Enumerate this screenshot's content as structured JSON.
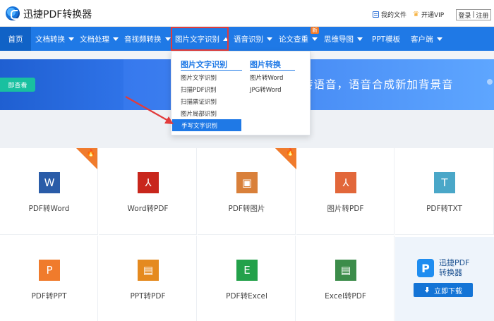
{
  "header": {
    "brand": "迅捷PDF转换器",
    "my_files": "我的文件",
    "vip": "开通VIP",
    "login": "登录",
    "register": "注册"
  },
  "nav": {
    "items": [
      {
        "label": "首页"
      },
      {
        "label": "文档转换"
      },
      {
        "label": "文档处理"
      },
      {
        "label": "音视频转换"
      },
      {
        "label": "图片文字识别"
      },
      {
        "label": "语音识别"
      },
      {
        "label": "论文查重"
      },
      {
        "label": "思维导图"
      },
      {
        "label": "PPT模板"
      },
      {
        "label": "客户端"
      }
    ],
    "new_badge": "新"
  },
  "banner": {
    "button": "即查看",
    "text": "转语音，语音合成新加背景音"
  },
  "dropdown": {
    "col1_title": "图片文字识别",
    "col1_items": [
      "图片文字识别",
      "扫描PDF识别",
      "扫描票证识别",
      "图片局部识别",
      "手写文字识别"
    ],
    "col2_title": "图片转换",
    "col2_items": [
      "图片转Word",
      "JPG转Word"
    ]
  },
  "tools": [
    {
      "label": "PDF转Word",
      "glyph": "W",
      "color": "#2a5ca8",
      "hot": true
    },
    {
      "label": "Word转PDF",
      "glyph": "⅄",
      "color": "#c8261c",
      "hot": false
    },
    {
      "label": "PDF转图片",
      "glyph": "▣",
      "color": "#d9803a",
      "hot": true
    },
    {
      "label": "图片转PDF",
      "glyph": "⅄",
      "color": "#e2673a",
      "hot": false
    },
    {
      "label": "PDF转TXT",
      "glyph": "T",
      "color": "#4aa7c8",
      "hot": false
    },
    {
      "label": "PDF转PPT",
      "glyph": "P",
      "color": "#f07b2c",
      "hot": false
    },
    {
      "label": "PPT转PDF",
      "glyph": "▤",
      "color": "#e58a1f",
      "hot": false
    },
    {
      "label": "PDF转Excel",
      "glyph": "E",
      "color": "#23a14a",
      "hot": false
    },
    {
      "label": "Excel转PDF",
      "glyph": "▤",
      "color": "#3c8c4a",
      "hot": false
    }
  ],
  "promo": {
    "title_line1": "迅捷PDF",
    "title_line2": "转换器",
    "download": "立即下载"
  }
}
